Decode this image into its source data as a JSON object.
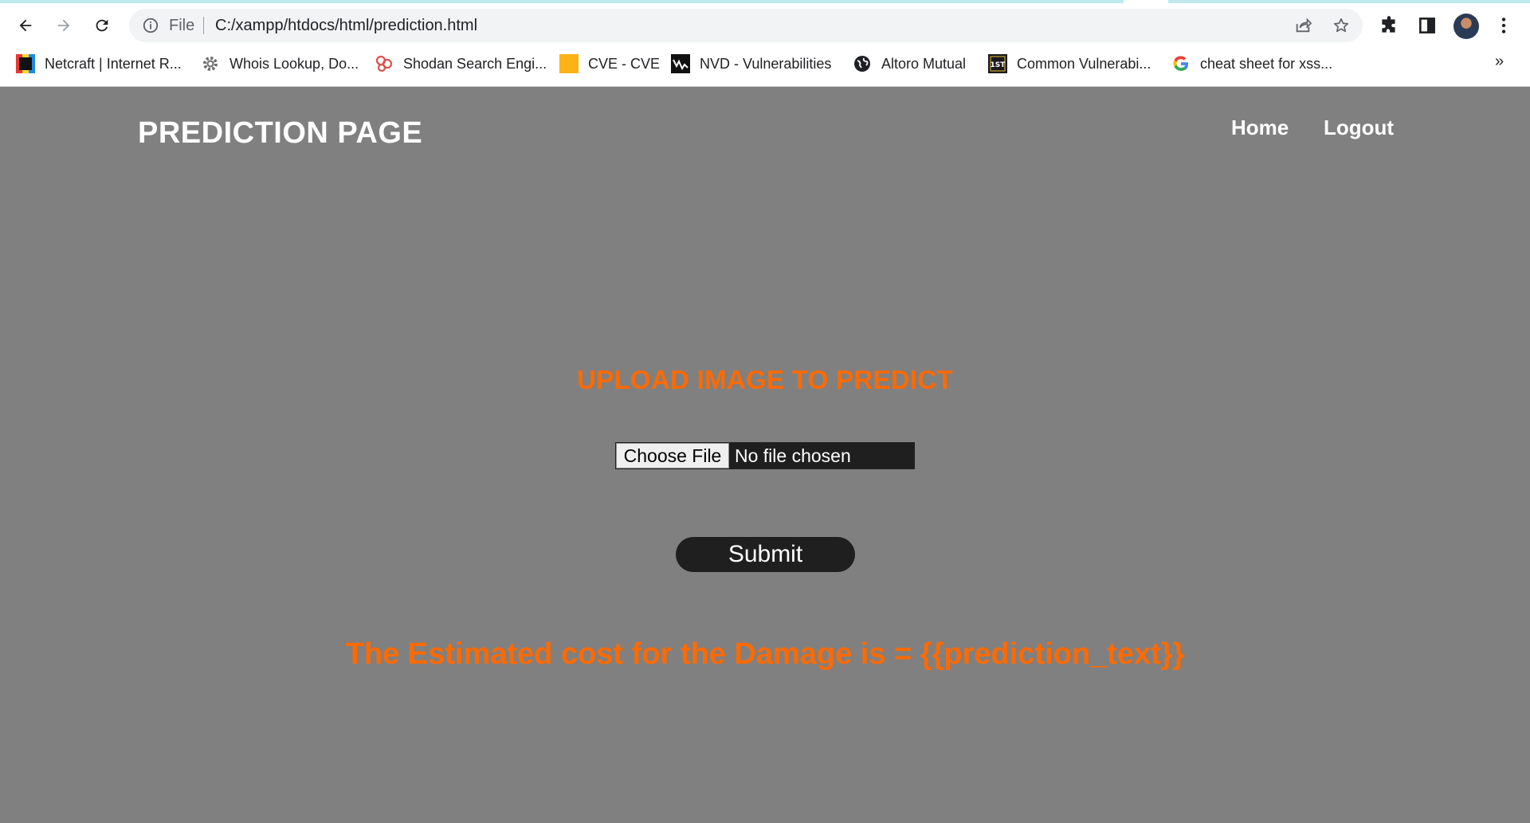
{
  "browser": {
    "address_scheme": "File",
    "address_url": "C:/xampp/htdocs/html/prediction.html",
    "bookmarks": [
      {
        "label": "Netcraft | Internet R...",
        "icon": "netcraft-icon"
      },
      {
        "label": "Whois Lookup, Do...",
        "icon": "gear-icon"
      },
      {
        "label": "Shodan Search Engi...",
        "icon": "shodan-icon"
      },
      {
        "label": "CVE - CVE",
        "icon": "cve-icon"
      },
      {
        "label": "NVD - Vulnerabilities",
        "icon": "nvd-icon"
      },
      {
        "label": "Altoro Mutual",
        "icon": "globe-icon"
      },
      {
        "label": "Common Vulnerabi...",
        "icon": "1st-icon"
      },
      {
        "label": "cheat sheet for xss...",
        "icon": "google-icon"
      }
    ],
    "bookmarks_more": "»"
  },
  "page": {
    "title": "PREDICTION PAGE",
    "nav": {
      "home": "Home",
      "logout": "Logout"
    },
    "upload_heading": "UPLOAD IMAGE TO PREDICT",
    "file_input": {
      "button_label": "Choose File",
      "status": "No file chosen"
    },
    "submit_label": "Submit",
    "result_text": "The Estimated cost for the Damage is = {{prediction_text}}"
  },
  "colors": {
    "page_background": "#808080",
    "accent": "#ff6a00",
    "button_dark": "#1f1f1f"
  }
}
